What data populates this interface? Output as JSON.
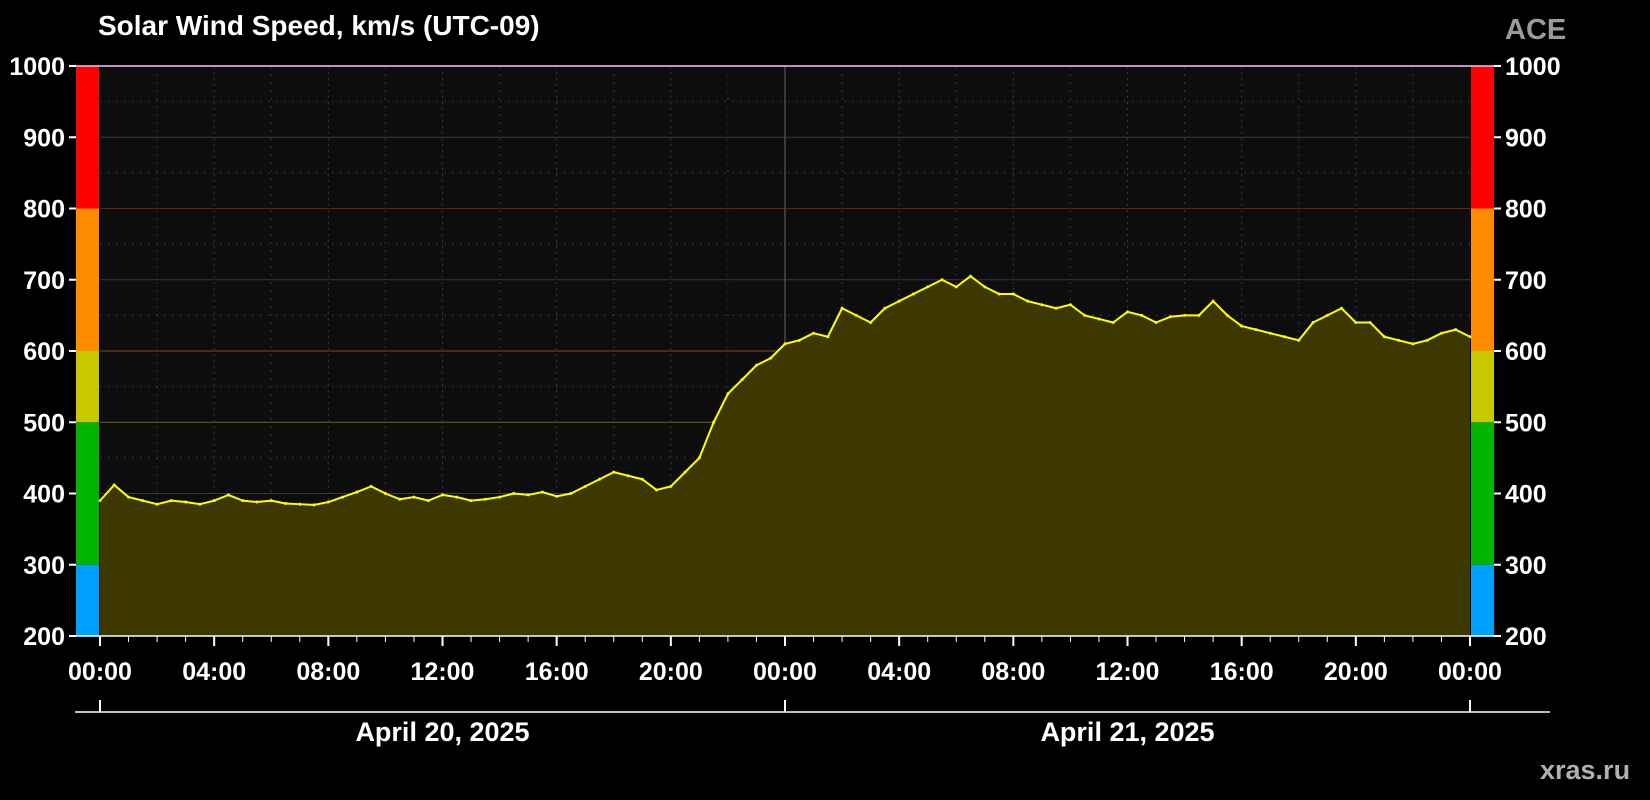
{
  "chart_data": {
    "type": "area",
    "title": "Solar Wind Speed, km/s (UTC-09)",
    "source_label": "ACE",
    "credit": "xras.ru",
    "ylim": [
      200,
      1000
    ],
    "y_ticks": [
      200,
      300,
      400,
      500,
      600,
      700,
      800,
      900,
      1000
    ],
    "x_ticks": [
      "00:00",
      "04:00",
      "08:00",
      "12:00",
      "16:00",
      "20:00",
      "00:00",
      "04:00",
      "08:00",
      "12:00",
      "16:00",
      "20:00",
      "00:00"
    ],
    "dates": [
      "April 20, 2025",
      "April 21, 2025"
    ],
    "xlim_hours": [
      0,
      48
    ],
    "x_unit": "hours since April 20, 2025 00:00",
    "threshold_bands": [
      {
        "from": 200,
        "to": 300,
        "color": "#00a0ff"
      },
      {
        "from": 300,
        "to": 500,
        "color": "#00b400"
      },
      {
        "from": 500,
        "to": 600,
        "color": "#c8c800"
      },
      {
        "from": 600,
        "to": 800,
        "color": "#ff8c00"
      },
      {
        "from": 800,
        "to": 1000,
        "color": "#ff0000"
      }
    ],
    "colors": {
      "line": "#ffff00",
      "fill": "#3d3800",
      "plot_bg": "#0d0d0d",
      "grid": "#3a3a3a"
    },
    "series": [
      {
        "x": [
          0,
          0.5,
          1,
          1.5,
          2,
          2.5,
          3,
          3.5,
          4,
          4.5,
          5,
          5.5,
          6,
          6.5,
          7,
          7.5,
          8,
          8.5,
          9,
          9.5,
          10,
          10.5,
          11,
          11.5,
          12,
          12.5,
          13,
          13.5,
          14,
          14.5,
          15,
          15.5,
          16,
          16.5,
          17,
          17.5,
          18,
          18.5,
          19,
          19.5,
          20,
          20.5,
          21,
          21.5,
          22,
          22.5,
          23,
          23.5,
          24,
          24.5,
          25,
          25.5,
          26,
          26.5,
          27,
          27.5,
          28,
          28.5,
          29,
          29.5,
          30,
          30.5,
          31,
          31.5,
          32,
          32.5,
          33,
          33.5,
          34,
          34.5,
          35,
          35.5,
          36,
          36.5,
          37,
          37.5,
          38,
          38.5,
          39,
          39.5,
          40,
          40.5,
          41,
          41.5,
          42,
          42.5,
          43,
          43.5,
          44,
          44.5,
          45,
          45.5,
          46,
          46.5,
          47,
          47.5,
          48
        ],
        "values": [
          390,
          412,
          395,
          390,
          385,
          390,
          388,
          385,
          390,
          398,
          390,
          388,
          390,
          386,
          385,
          384,
          388,
          395,
          402,
          410,
          400,
          392,
          395,
          390,
          398,
          395,
          390,
          392,
          395,
          400,
          398,
          402,
          396,
          400,
          410,
          420,
          430,
          425,
          420,
          405,
          410,
          430,
          450,
          500,
          540,
          560,
          580,
          590,
          610,
          615,
          625,
          620,
          660,
          650,
          640,
          660,
          670,
          680,
          690,
          700,
          690,
          705,
          690,
          680,
          680,
          670,
          665,
          660,
          665,
          650,
          645,
          640,
          655,
          650,
          640,
          648,
          650,
          650,
          670,
          650,
          635,
          630,
          625,
          620,
          615,
          640,
          650,
          660,
          640,
          640,
          620,
          615,
          610,
          615,
          625,
          630,
          620
        ]
      }
    ]
  }
}
